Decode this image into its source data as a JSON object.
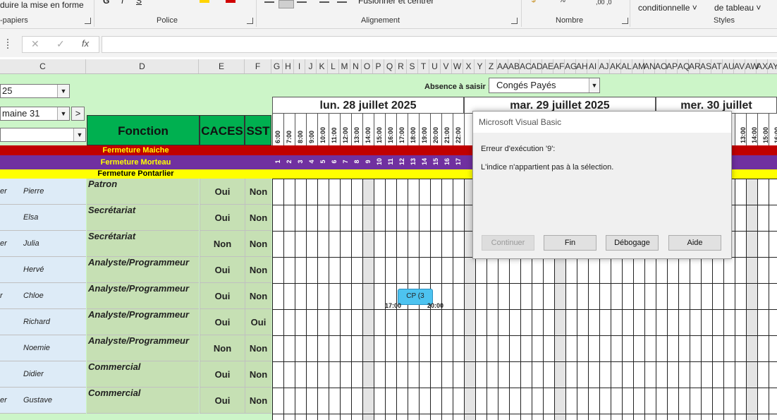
{
  "ribbon": {
    "clipboard_text": "duire la mise en forme",
    "clipboard_label": "-papiers",
    "font_label": "Police",
    "alignment_merge": "Fusionner et centrer",
    "alignment_label": "Alignement",
    "number_label": "Nombre",
    "number_decimals": ",00  ,0",
    "conditional": "conditionnelle",
    "table_format": "de tableau",
    "styles_label": "Styles"
  },
  "formula_bar": {
    "fx": "fx",
    "cancel": "✕",
    "confirm": "✓",
    "value": ""
  },
  "columns": [
    "C",
    "D",
    "E",
    "F",
    "G",
    "H",
    "I",
    "J",
    "K",
    "L",
    "M",
    "N",
    "O",
    "P",
    "Q",
    "R",
    "S",
    "T",
    "U",
    "V",
    "W",
    "X",
    "Y",
    "Z",
    "AA",
    "AB",
    "AC",
    "AD",
    "AE",
    "AF",
    "AG",
    "AH",
    "AI",
    "AJ",
    "AK",
    "AL",
    "AM",
    "AN",
    "AO",
    "AP",
    "AQ",
    "AR",
    "AS",
    "AT",
    "AU",
    "AV",
    "AW",
    "AX",
    "AY"
  ],
  "sheet": {
    "year_combo": "25",
    "week_combo": "maine 31",
    "next_button": ">",
    "absence_label": "Absence à saisir :",
    "absence_value": "Congés Payés",
    "headers": {
      "fonction": "Fonction",
      "caces": "CACES",
      "sst": "SST"
    },
    "days": [
      "lun. 28 juillet 2025",
      "mar. 29 juillet 2025",
      "mer. 30 juillet"
    ],
    "hours": [
      "6:00",
      "7:00",
      "8:00",
      "9:00",
      "10:00",
      "11:00",
      "12:00",
      "13:00",
      "14:00",
      "15:00",
      "16:00",
      "17:00",
      "18:00",
      "19:00",
      "20:00",
      "21:00",
      "22:00"
    ],
    "hours_right": [
      "13:00",
      "14:00",
      "15:00",
      "16:00"
    ],
    "slots": [
      "1",
      "2",
      "3",
      "4",
      "5",
      "6",
      "7",
      "8",
      "9",
      "10",
      "11",
      "12",
      "13",
      "14",
      "15",
      "16",
      "17"
    ],
    "bands": [
      {
        "label": "Fermeture Maiche",
        "color": "#c00000",
        "text": "#ffff00"
      },
      {
        "label": "Fermeture Morteau",
        "color": "#7030a0",
        "text": "#ffff00"
      },
      {
        "label": "Fermeture Pontarlier",
        "color": "#ffff00",
        "text": "#000000"
      }
    ],
    "employees": [
      {
        "prefix": "er",
        "name": "Pierre",
        "fonction": "Patron",
        "caces": "Oui",
        "sst": "Non"
      },
      {
        "prefix": "",
        "name": "Elsa",
        "fonction": "Secrétariat",
        "caces": "Oui",
        "sst": "Non"
      },
      {
        "prefix": "er",
        "name": "Julia",
        "fonction": "Secrétariat",
        "caces": "Non",
        "sst": "Non"
      },
      {
        "prefix": "",
        "name": "Hervé",
        "fonction": "Analyste/Programmeur",
        "caces": "Oui",
        "sst": "Non"
      },
      {
        "prefix": "r",
        "name": "Chloe",
        "fonction": "Analyste/Programmeur",
        "caces": "Oui",
        "sst": "Non"
      },
      {
        "prefix": "",
        "name": "Richard",
        "fonction": "Analyste/Programmeur",
        "caces": "Oui",
        "sst": "Oui"
      },
      {
        "prefix": "",
        "name": "Noemie",
        "fonction": "Analyste/Programmeur",
        "caces": "Non",
        "sst": "Non"
      },
      {
        "prefix": "",
        "name": "Didier",
        "fonction": "Commercial",
        "caces": "Oui",
        "sst": "Non"
      },
      {
        "prefix": "er",
        "name": "Gustave",
        "fonction": "Commercial",
        "caces": "Oui",
        "sst": "Non"
      }
    ],
    "absence_block": {
      "label": "CP (3",
      "start": "17:00",
      "end": "20:00"
    }
  },
  "dialog": {
    "title": "Microsoft Visual Basic",
    "error": "Erreur d'exécution '9':",
    "message": "L'indice n'appartient pas à la sélection.",
    "buttons": {
      "continue": "Continuer",
      "end": "Fin",
      "debug": "Débogage",
      "help": "Aide"
    }
  }
}
